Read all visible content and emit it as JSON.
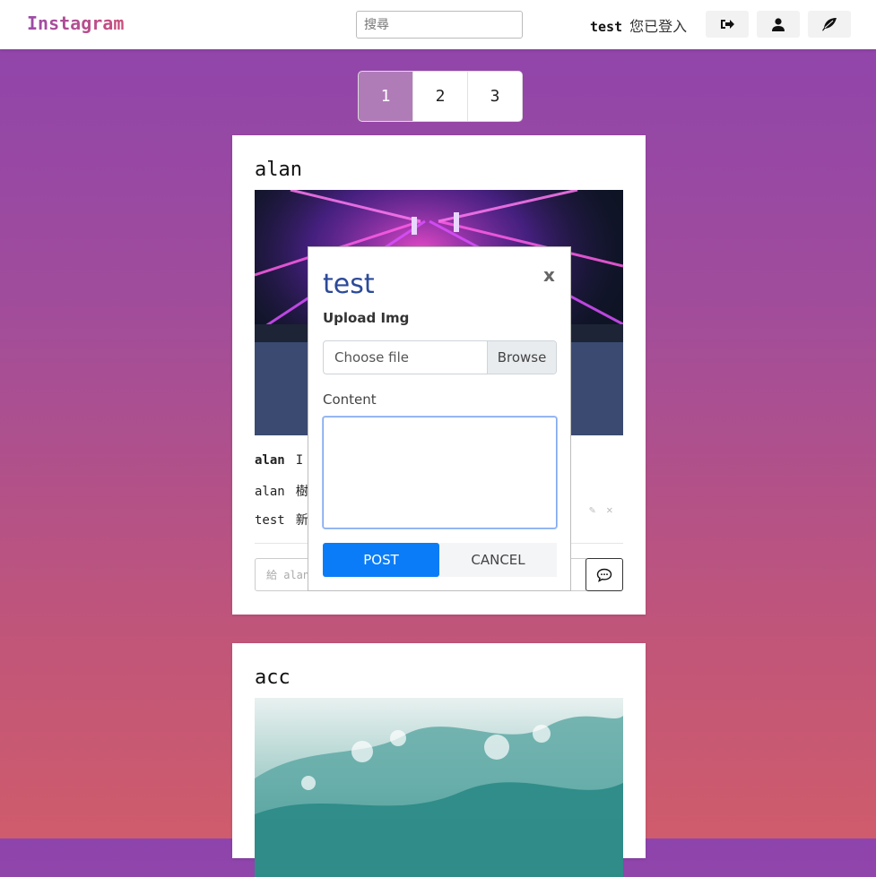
{
  "navbar": {
    "brand": "Instagram",
    "search_placeholder": "搜尋",
    "username": "test",
    "login_status": "您已登入",
    "icons": [
      "sign-out-icon",
      "user-icon",
      "feather-icon"
    ]
  },
  "pagination": {
    "pages": [
      "1",
      "2",
      "3"
    ],
    "active": "1"
  },
  "posts": [
    {
      "author": "alan",
      "caption_user": "alan",
      "caption_text": "I",
      "comments": [
        {
          "user": "alan",
          "text": "樹"
        },
        {
          "user": "test",
          "text": "新"
        }
      ],
      "comment_placeholder": "給 alan"
    },
    {
      "author": "acc"
    }
  ],
  "modal": {
    "title": "test",
    "upload_label": "Upload Img",
    "file_placeholder": "Choose file",
    "browse_label": "Browse",
    "content_label": "Content",
    "post_label": "POST",
    "cancel_label": "CANCEL"
  }
}
